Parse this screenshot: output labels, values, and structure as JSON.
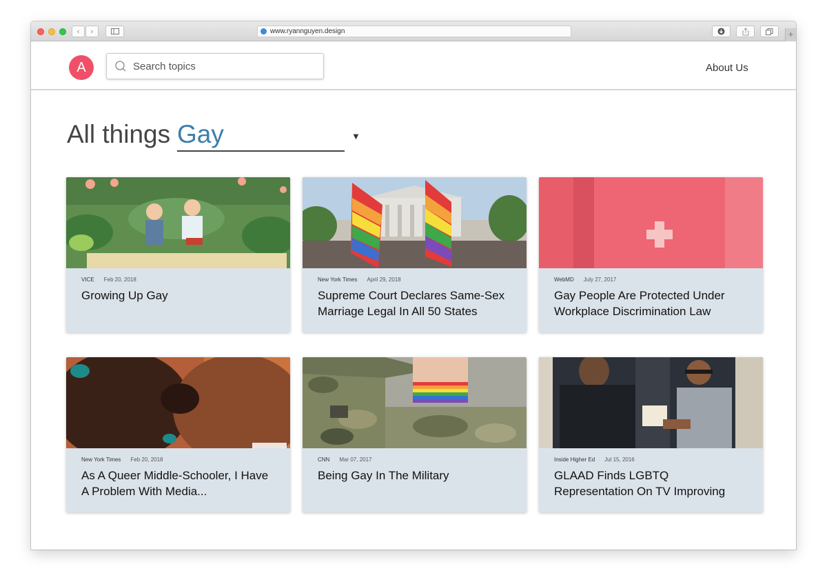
{
  "browser": {
    "url": "www.ryannguyen.design",
    "nav_back": "‹",
    "nav_forward": "›",
    "new_tab": "+"
  },
  "header": {
    "logo_letter": "A",
    "search_placeholder": "Search topics",
    "about_link": "About Us"
  },
  "heading": {
    "prefix": "All things",
    "topic": "Gay",
    "caret": "▼"
  },
  "cards": [
    {
      "source": "VICE",
      "date": "Feb 20, 2018",
      "title": "Growing Up Gay"
    },
    {
      "source": "New York Times",
      "date": "April 29, 2018",
      "title": "Supreme Court Declares Same-Sex Marriage Legal In All 50 States"
    },
    {
      "source": "WebMD",
      "date": "July 27, 2017",
      "title": "Gay People Are Protected Under Workplace Discrimination Law"
    },
    {
      "source": "New York Times",
      "date": "Feb 20, 2018",
      "title": "As A Queer Middle-Schooler, I Have A Problem With Media..."
    },
    {
      "source": "CNN",
      "date": "Mar 07, 2017",
      "title": "Being Gay In The Military"
    },
    {
      "source": "Inside Higher Ed",
      "date": "Jul 15, 2016",
      "title": "GLAAD Finds LGBTQ Representation On TV Improving"
    }
  ],
  "colors": {
    "accent": "#ef5068",
    "topic": "#3a7fac",
    "card_bg": "#dbe3ea"
  }
}
